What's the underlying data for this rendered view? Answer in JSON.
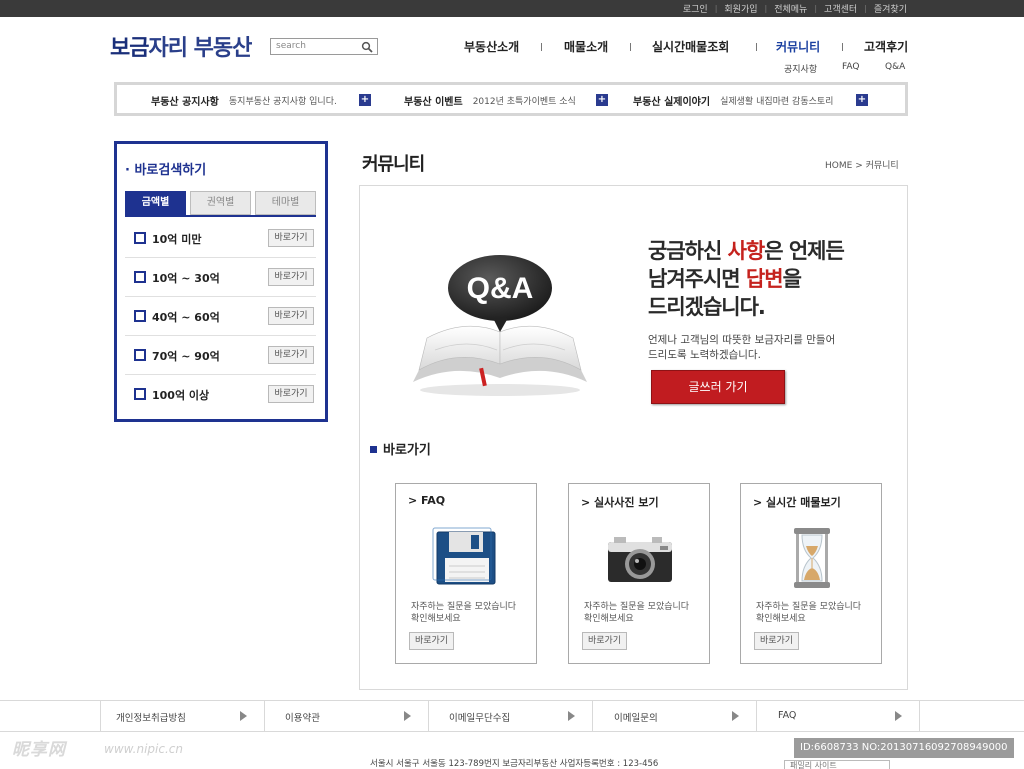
{
  "top_links": [
    "로그인",
    "회원가입",
    "전체메뉴",
    "고객센터",
    "즐겨찾기"
  ],
  "logo": {
    "highlight": "보금",
    "rest": "자리 부동산"
  },
  "search": {
    "placeholder": "search"
  },
  "gnb": {
    "items": [
      "부동산소개",
      "매물소개",
      "실시간매물조회",
      "커뮤니티",
      "고객후기"
    ],
    "active_index": 3,
    "sub_items": [
      "공지사항",
      "FAQ",
      "Q&A"
    ]
  },
  "notices": [
    {
      "title": "부동산 공지사항",
      "desc": "동지부동산 공지사항 입니다."
    },
    {
      "title": "부동산 이벤트",
      "desc": "2012년 초특가이벤트 소식"
    },
    {
      "title": "부동산 실제이야기",
      "desc": "실제생활 내집마련 감동스토리"
    }
  ],
  "quick_search": {
    "title": "바로검색하기",
    "tabs": [
      "금액별",
      "권역별",
      "테마별"
    ],
    "active_tab": 0,
    "rows": [
      "10억 미만",
      "10억 ~ 30억",
      "40억 ~ 60억",
      "70억 ~ 90억",
      "100억 이상"
    ],
    "go_label": "바로가기"
  },
  "page": {
    "title": "커뮤니티",
    "breadcrumb_home": "HOME",
    "breadcrumb_current": "커뮤니티"
  },
  "hero": {
    "bubble_text": "Q&A",
    "line1_a": "궁금하신 ",
    "line1_red": "사항",
    "line1_b": "은 언제든",
    "line2_a": "남겨주시면 ",
    "line2_red": "답변",
    "line2_b": "을",
    "line3": "드리겠습니다.",
    "sub1": "언제나 고객님의 따뜻한 보금자리를 만들어",
    "sub2": "드리도록 노력하겠습니다.",
    "button": "글쓰러 가기"
  },
  "shortcut_title": "바로가기",
  "cards": [
    {
      "title": "FAQ",
      "icon": "floppy-disk-icon",
      "desc1": "자주하는 질문을 모았습니다",
      "desc2": "확인해보세요",
      "button": "바로가기"
    },
    {
      "title": "실사사진 보기",
      "icon": "camera-icon",
      "desc1": "자주하는 질문을 모았습니다",
      "desc2": "확인해보세요",
      "button": "바로가기"
    },
    {
      "title": "실시간 매물보기",
      "icon": "hourglass-icon",
      "desc1": "자주하는 질문을 모았습니다",
      "desc2": "확인해보세요",
      "button": "바로가기"
    }
  ],
  "footer_nav": [
    "개인정보취급방침",
    "이용약관",
    "이메일무단수집",
    "이메일문의",
    "FAQ"
  ],
  "address": "서울시 서울구 서울동 123-789번지 보금자리부동산 사업자등록번호 : 123-456",
  "watermark": {
    "brand": "昵享网",
    "url": "www.nipic.cn",
    "id_text": "ID:6608733 NO:20130716092708949000"
  },
  "family_site": "패밀리 사이트",
  "colors": {
    "brand_blue": "#1e3290",
    "accent_red": "#c11c20",
    "topbar": "#3a3a3a"
  }
}
